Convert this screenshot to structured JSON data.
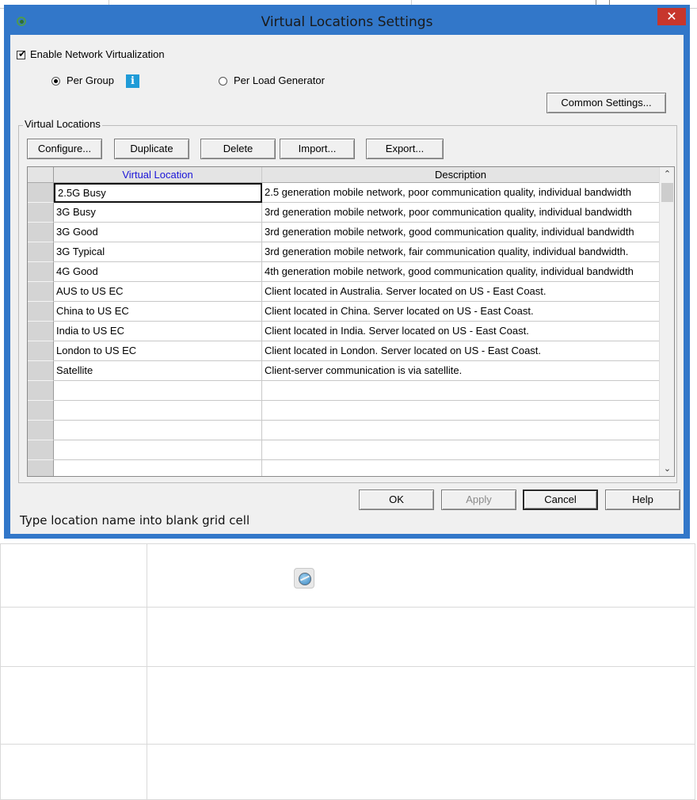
{
  "dialog": {
    "title": "Virtual Locations Settings",
    "close_glyph": "✕"
  },
  "options": {
    "enable_network_virtualization": {
      "label": "Enable Network Virtualization",
      "checked": true
    },
    "per_group": {
      "label": "Per Group",
      "selected": true
    },
    "info_glyph": "i",
    "per_load_generator": {
      "label": "Per Load Generator",
      "selected": false
    },
    "common_settings_label": "Common Settings..."
  },
  "virtual_locations": {
    "group_label": "Virtual Locations",
    "toolbar": {
      "configure": "Configure...",
      "duplicate": "Duplicate",
      "delete": "Delete",
      "import": "Import...",
      "export": "Export..."
    },
    "grid": {
      "columns": [
        "Virtual Location",
        "Description"
      ],
      "rows": [
        {
          "name": "2.5G Busy",
          "description": "2.5 generation mobile network, poor communication quality, individual bandwidth"
        },
        {
          "name": "3G Busy",
          "description": "3rd generation mobile network, poor communication quality, individual bandwidth"
        },
        {
          "name": "3G Good",
          "description": "3rd generation mobile network, good communication quality, individual bandwidth"
        },
        {
          "name": "3G Typical",
          "description": "3rd generation mobile network, fair communication quality, individual bandwidth."
        },
        {
          "name": "4G Good",
          "description": "4th generation mobile network, good communication quality, individual bandwidth"
        },
        {
          "name": "AUS to US EC",
          "description": "Client located in Australia. Server located on US - East Coast."
        },
        {
          "name": "China to US EC",
          "description": "Client located in China. Server located on US - East Coast."
        },
        {
          "name": "India to US EC",
          "description": "Client located in India. Server located on US - East Coast."
        },
        {
          "name": "London to US EC",
          "description": "Client located in London. Server located on US - East Coast."
        },
        {
          "name": "Satellite",
          "description": "Client-server communication is via satellite."
        },
        {
          "name": "",
          "description": ""
        },
        {
          "name": "",
          "description": ""
        },
        {
          "name": "",
          "description": ""
        },
        {
          "name": "",
          "description": ""
        },
        {
          "name": "",
          "description": ""
        }
      ],
      "scroll_up_glyph": "⌃",
      "scroll_down_glyph": "⌄"
    }
  },
  "footer_buttons": {
    "ok": "OK",
    "apply": "Apply",
    "cancel": "Cancel",
    "help": "Help"
  },
  "status_text": "Type location name into blank grid cell",
  "colors": {
    "title_bar": "#3277c9",
    "close_button": "#c7362c",
    "header_link": "#1a14d8",
    "info_icon": "#1f9bd7"
  },
  "icons": [
    "app-icon",
    "info-icon",
    "close-icon",
    "globe-icon"
  ]
}
